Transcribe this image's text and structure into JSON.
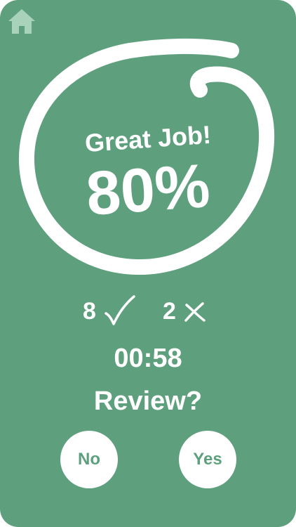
{
  "colors": {
    "background": "#5e9f7d",
    "foreground": "#ffffff",
    "home_icon": "#a9d2bb",
    "button_text": "#5e9f7d"
  },
  "nav": {
    "home_icon": "home-icon"
  },
  "result": {
    "title": "Great Job!",
    "percent": "80%",
    "score_fraction": 0.8
  },
  "tally": {
    "correct_count": "8",
    "correct_icon": "check-icon",
    "wrong_count": "2",
    "wrong_icon": "cross-icon"
  },
  "timer": "00:58",
  "review": {
    "question": "Review?",
    "no_label": "No",
    "yes_label": "Yes"
  }
}
